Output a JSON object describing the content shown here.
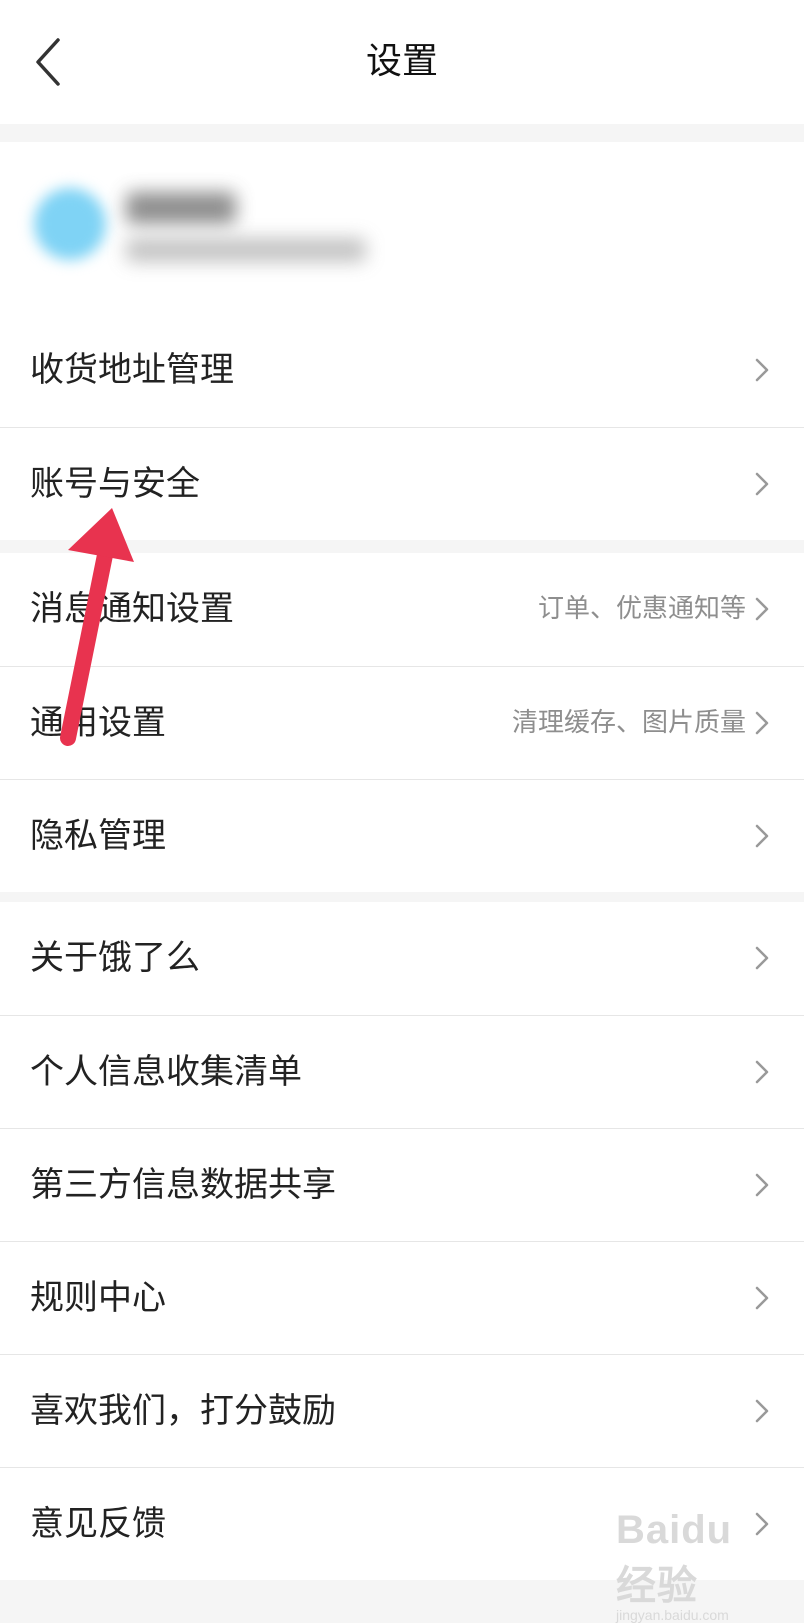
{
  "header": {
    "title": "设置",
    "back_icon": "chevron-left-icon"
  },
  "profile": {
    "avatar_color": "#7fd3f5"
  },
  "sections": [
    {
      "items": [
        {
          "label": "收货地址管理",
          "hint": ""
        },
        {
          "label": "账号与安全",
          "hint": ""
        }
      ]
    },
    {
      "items": [
        {
          "label": "消息通知设置",
          "hint": "订单、优惠通知等"
        },
        {
          "label": "通用设置",
          "hint": "清理缓存、图片质量"
        },
        {
          "label": "隐私管理",
          "hint": ""
        }
      ]
    },
    {
      "items": [
        {
          "label": "关于饿了么",
          "hint": ""
        },
        {
          "label": "个人信息收集清单",
          "hint": ""
        },
        {
          "label": "第三方信息数据共享",
          "hint": ""
        },
        {
          "label": "规则中心",
          "hint": ""
        },
        {
          "label": "喜欢我们，打分鼓励",
          "hint": ""
        },
        {
          "label": "意见反馈",
          "hint": ""
        }
      ]
    }
  ],
  "row_icon": "chevron-right-icon",
  "annotation": {
    "arrow_color": "#e8334f"
  },
  "watermark": {
    "logo": "Baidu经验",
    "url": "jingyan.baidu.com"
  }
}
